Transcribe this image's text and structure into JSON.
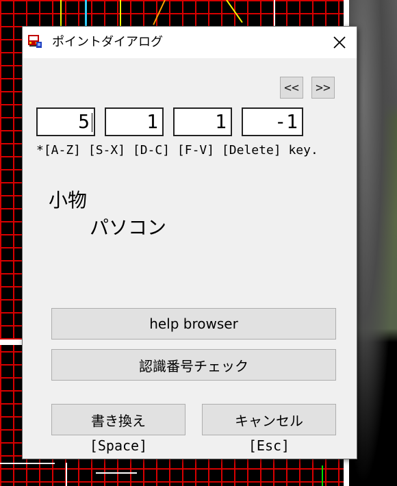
{
  "dialog": {
    "title": "ポイントダイアログ",
    "close_label": "✕",
    "prev_label": "<<",
    "next_label": ">>",
    "fields": [
      "5",
      "1",
      "1",
      "-1"
    ],
    "key_hint": "*[A-Z] [S-X] [D-C] [F-V] [Delete] key.",
    "category": "小物",
    "item_name": "パソコン",
    "help_button": "help browser",
    "check_button": "認識番号チェック",
    "rewrite_button": "書き換え",
    "rewrite_shortcut": "[Space]",
    "cancel_button": "キャンセル",
    "cancel_shortcut": "[Esc]"
  },
  "colors": {
    "grid": "#d80000",
    "dialog_bg": "#f0f0f0",
    "button_bg": "#e1e1e1"
  },
  "icons": {
    "app_icon": "train-icon"
  }
}
